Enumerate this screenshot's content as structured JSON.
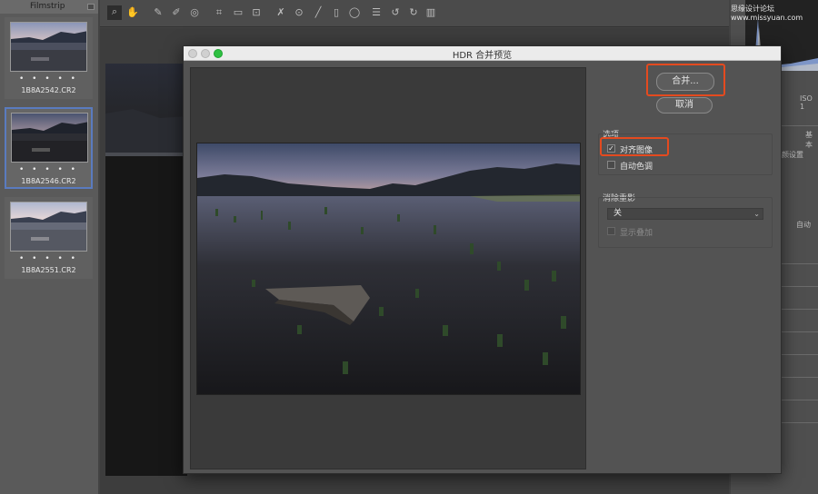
{
  "filmstrip": {
    "header": "Filmstrip",
    "items": [
      {
        "name": "1B8A2542.CR2",
        "dots": "• • • • •",
        "selected": false
      },
      {
        "name": "1B8A2546.CR2",
        "dots": "• • • • •",
        "selected": true
      },
      {
        "name": "1B8A2551.CR2",
        "dots": "• • • • •",
        "selected": false
      }
    ]
  },
  "toolbar": {
    "tools": [
      "zoom-icon",
      "hand-icon",
      "white-balance-icon",
      "color-sampler-icon",
      "target-adjust-icon",
      "crop-icon",
      "straighten-icon",
      "transform-icon",
      "spot-removal-icon",
      "red-eye-icon",
      "adjustment-brush-icon",
      "graduated-filter-icon",
      "radial-filter-icon",
      "preferences-icon",
      "rotate-left-icon",
      "rotate-right-icon",
      "trash-icon"
    ]
  },
  "right_panel": {
    "watermark": "思缘设计论坛 www.missyuan.com",
    "iso": "ISO 1",
    "basic": "基本",
    "settings": "颜设置",
    "auto": "自动"
  },
  "dialog": {
    "title": "HDR 合并预览",
    "merge_button": "合并...",
    "cancel_button": "取消",
    "options_label": "选项",
    "align_images_label": "对齐图像",
    "align_images_checked": true,
    "auto_tone_label": "自动色调",
    "auto_tone_checked": false,
    "deghost_label": "消除重影",
    "deghost_value": "关",
    "show_overlay_label": "显示叠加",
    "show_overlay_checked": false,
    "highlight_color": "#e44a1f"
  }
}
